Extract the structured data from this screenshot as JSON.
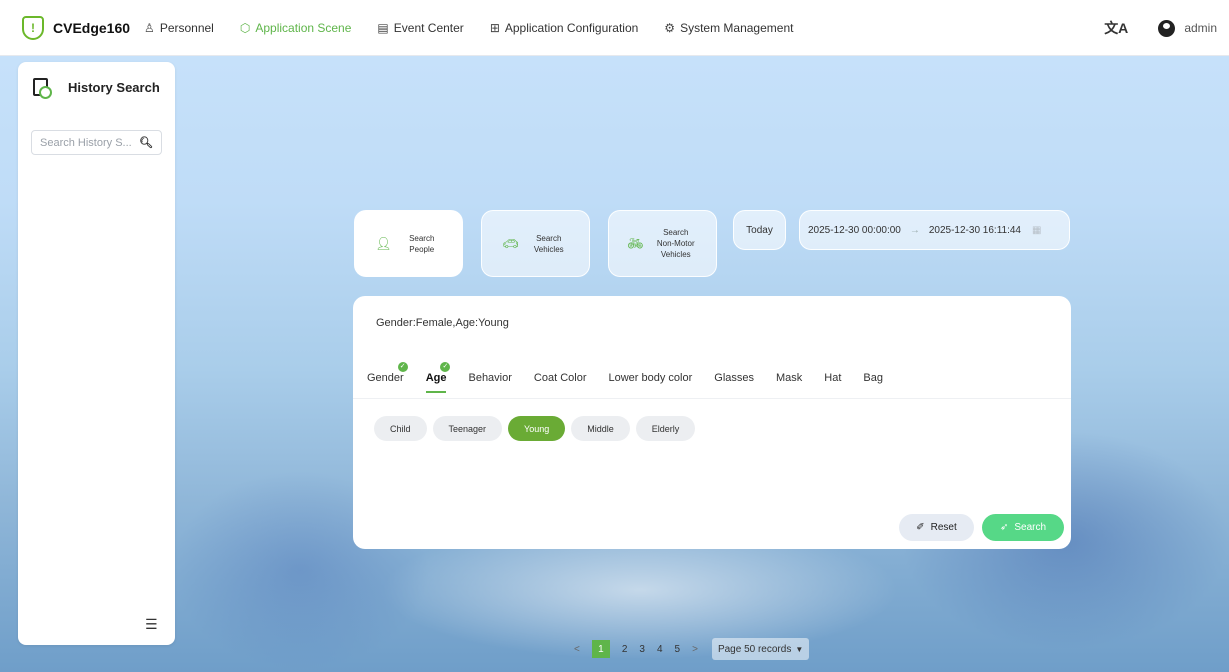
{
  "app": {
    "title": "CVEdge160",
    "user": "admin"
  },
  "nav": [
    {
      "icon": "person-icon",
      "label": "Personnel"
    },
    {
      "icon": "scene-icon",
      "label": "Application Scene",
      "active": true
    },
    {
      "icon": "event-icon",
      "label": "Event Center"
    },
    {
      "icon": "grid-icon",
      "label": "Application Configuration"
    },
    {
      "icon": "gear-icon",
      "label": "System Management"
    }
  ],
  "sidebar": {
    "title": "History Search",
    "search_placeholder": "Search History S..."
  },
  "search_types": [
    {
      "label": "Search People",
      "icon": "person-icon",
      "active": true
    },
    {
      "label": "Search Vehicles",
      "icon": "car-icon"
    },
    {
      "label": "Search Non-Motor Vehicles",
      "icon": "bicycle-icon"
    }
  ],
  "date_filter": {
    "quick": "Today",
    "start": "2025-12-30 00:00:00",
    "end": "2025-12-30 16:11:44"
  },
  "summary": "Gender:Female,Age:Young",
  "attribute_tabs": [
    {
      "label": "Gender",
      "checked": true
    },
    {
      "label": "Age",
      "checked": true,
      "active": true
    },
    {
      "label": "Behavior"
    },
    {
      "label": "Coat Color"
    },
    {
      "label": "Lower body color"
    },
    {
      "label": "Glasses"
    },
    {
      "label": "Mask"
    },
    {
      "label": "Hat"
    },
    {
      "label": "Bag"
    }
  ],
  "age_options": [
    {
      "label": "Child"
    },
    {
      "label": "Teenager"
    },
    {
      "label": "Young",
      "selected": true
    },
    {
      "label": "Middle"
    },
    {
      "label": "Elderly"
    }
  ],
  "actions": {
    "reset": "Reset",
    "search": "Search"
  },
  "pagination": {
    "prev": "<",
    "pages": [
      "1",
      "2",
      "3",
      "4",
      "5"
    ],
    "current": "1",
    "next": ">",
    "page_size": "Page 50 records"
  },
  "colors": {
    "accent": "#5fb54a",
    "search_button": "#56d887"
  }
}
